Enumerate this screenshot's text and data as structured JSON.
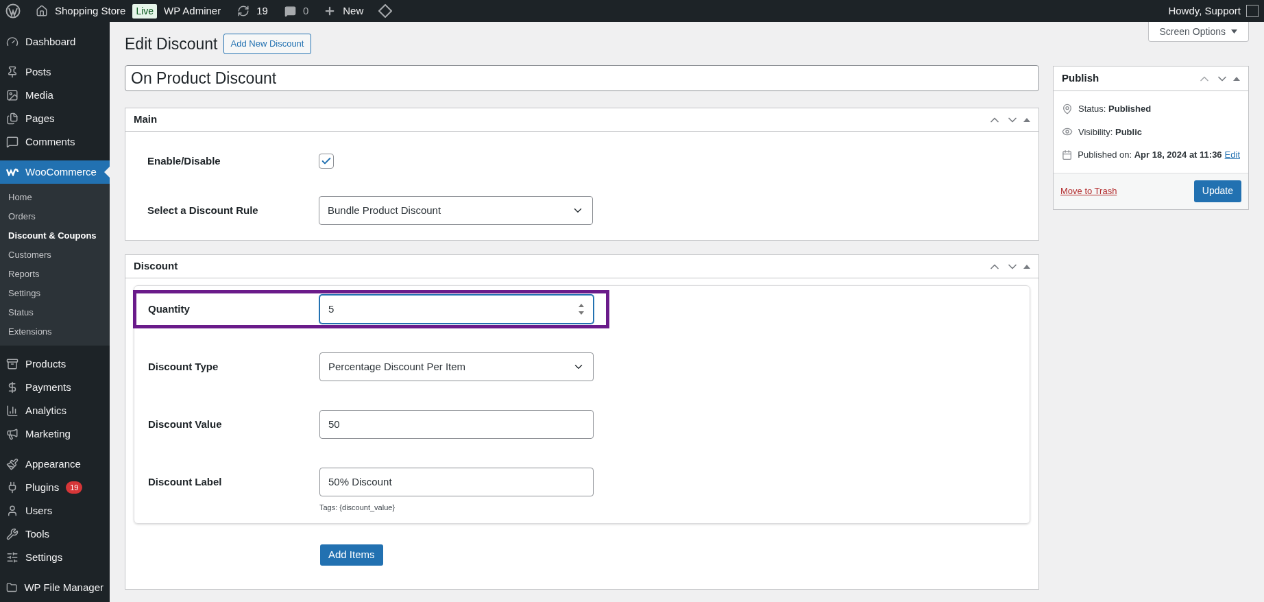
{
  "admin_bar": {
    "site_name": "Shopping Store",
    "live_badge": "Live",
    "adminer": "WP Adminer",
    "updates": "19",
    "comments": "0",
    "new": "New",
    "greeting": "Howdy, Support"
  },
  "sidebar": {
    "groups": [
      {
        "items": [
          {
            "label": "Dashboard",
            "selected": false
          }
        ]
      },
      {
        "items": [
          {
            "label": "Posts",
            "selected": false
          },
          {
            "label": "Media",
            "selected": false
          },
          {
            "label": "Pages",
            "selected": false
          },
          {
            "label": "Comments",
            "selected": false
          }
        ]
      },
      {
        "items": [
          {
            "label": "WooCommerce",
            "selected": true,
            "submenu": [
              {
                "label": "Home",
                "selected": false
              },
              {
                "label": "Orders",
                "selected": false
              },
              {
                "label": "Discount & Coupons",
                "selected": true
              },
              {
                "label": "Customers",
                "selected": false
              },
              {
                "label": "Reports",
                "selected": false
              },
              {
                "label": "Settings",
                "selected": false
              },
              {
                "label": "Status",
                "selected": false
              },
              {
                "label": "Extensions",
                "selected": false
              }
            ]
          }
        ]
      },
      {
        "items": [
          {
            "label": "Products",
            "selected": false
          },
          {
            "label": "Payments",
            "selected": false
          },
          {
            "label": "Analytics",
            "selected": false
          },
          {
            "label": "Marketing",
            "selected": false
          }
        ]
      },
      {
        "items": [
          {
            "label": "Appearance",
            "selected": false
          },
          {
            "label": "Plugins",
            "selected": false,
            "badge": "19"
          },
          {
            "label": "Users",
            "selected": false
          },
          {
            "label": "Tools",
            "selected": false
          },
          {
            "label": "Settings",
            "selected": false
          }
        ]
      },
      {
        "items": [
          {
            "label": "WP File Manager",
            "selected": false
          }
        ]
      }
    ]
  },
  "screen_options": "Screen Options",
  "page": {
    "title": "Edit Discount",
    "add_new": "Add New Discount",
    "name_value": "On Product Discount"
  },
  "main_panel": {
    "title": "Main",
    "rows": [
      {
        "kind": "checkbox",
        "label": "Enable/Disable",
        "checked": true
      },
      {
        "kind": "select",
        "label": "Select a Discount Rule",
        "value": "Bundle Product Discount",
        "focused": false
      }
    ]
  },
  "discount_panel": {
    "title": "Discount",
    "rows": [
      {
        "kind": "number",
        "label": "Quantity",
        "value": "5",
        "focused": true,
        "highlighted": true
      },
      {
        "kind": "select",
        "label": "Discount Type",
        "value": "Percentage Discount Per Item",
        "focused": false,
        "highlighted": false
      },
      {
        "kind": "text",
        "label": "Discount Value",
        "value": "50",
        "focused": false,
        "highlighted": false
      },
      {
        "kind": "text",
        "label": "Discount Label",
        "value": "50% Discount",
        "hint": "Tags: {discount_value}",
        "focused": false,
        "highlighted": false
      }
    ],
    "add_button": "Add Items"
  },
  "publish": {
    "title": "Publish",
    "status_label": "Status:",
    "status": "Published",
    "visibility_label": "Visibility:",
    "visibility": "Public",
    "published_label": "Published on:",
    "published": "Apr 18, 2024 at 11:36",
    "edit_link": "Edit",
    "trash_link": "Move to Trash",
    "update_button": "Update"
  }
}
